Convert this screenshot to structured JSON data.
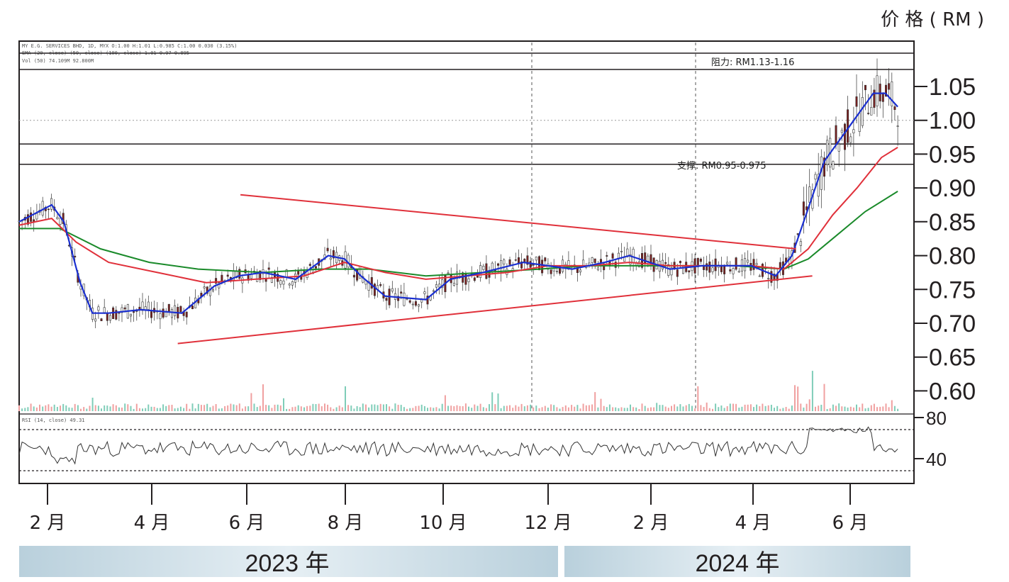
{
  "chart_data": {
    "type": "candlestick",
    "title": "",
    "y_axis_title": "价 格 ( RM )",
    "header_lines": [
      "MY E.G. SERVICES BHD, 1D, MYX  O:1.00  H:1.01  L:0.985  C:1.00  0.030 (3.15%)",
      "EMA (20, close) (50, close) (100, close)  1.01  0.97  0.895",
      "Vol (50)  74.109M  92.800M"
    ],
    "price_ticks": [
      "1.05",
      "1.00",
      "0.95",
      "0.90",
      "0.85",
      "0.80",
      "0.75",
      "0.70",
      "0.65",
      "0.60"
    ],
    "price_range": [
      0.57,
      1.115
    ],
    "rsi_label": "RSI (14, close)  49.31",
    "rsi_ticks": [
      "80",
      "40"
    ],
    "rsi_range": [
      0,
      100
    ],
    "rsi_bands": [
      70,
      30
    ],
    "months": [
      "2 月",
      "4 月",
      "6 月",
      "8 月",
      "10 月",
      "12 月",
      "2 月",
      "4 月",
      "6 月"
    ],
    "years": [
      "2023 年",
      "2024 年"
    ],
    "annotations": {
      "resistance": {
        "text": "阻力: RM1.13-1.16"
      },
      "support": {
        "text": "支撑: RM0.95-0.975",
        "range": [
          0.935,
          0.965
        ]
      }
    },
    "trendlines": {
      "upper": [
        {
          "x": 0.272,
          "y": 0.89
        },
        {
          "x": 0.955,
          "y": 0.81
        }
      ],
      "lower": [
        {
          "x": 0.195,
          "y": 0.67
        },
        {
          "x": 0.975,
          "y": 0.77
        }
      ]
    },
    "ema_points": {
      "ema20": [
        [
          0.0,
          0.85
        ],
        [
          0.04,
          0.875
        ],
        [
          0.055,
          0.85
        ],
        [
          0.075,
          0.76
        ],
        [
          0.09,
          0.715
        ],
        [
          0.11,
          0.715
        ],
        [
          0.15,
          0.72
        ],
        [
          0.2,
          0.715
        ],
        [
          0.24,
          0.755
        ],
        [
          0.27,
          0.77
        ],
        [
          0.3,
          0.775
        ],
        [
          0.34,
          0.765
        ],
        [
          0.38,
          0.8
        ],
        [
          0.4,
          0.795
        ],
        [
          0.42,
          0.77
        ],
        [
          0.45,
          0.74
        ],
        [
          0.5,
          0.735
        ],
        [
          0.53,
          0.765
        ],
        [
          0.57,
          0.775
        ],
        [
          0.62,
          0.79
        ],
        [
          0.68,
          0.78
        ],
        [
          0.72,
          0.79
        ],
        [
          0.75,
          0.8
        ],
        [
          0.8,
          0.78
        ],
        [
          0.84,
          0.785
        ],
        [
          0.87,
          0.785
        ],
        [
          0.9,
          0.785
        ],
        [
          0.93,
          0.77
        ],
        [
          0.95,
          0.8
        ],
        [
          0.97,
          0.87
        ],
        [
          0.99,
          0.94
        ],
        [
          1.02,
          0.99
        ],
        [
          1.05,
          1.04
        ],
        [
          1.065,
          1.04
        ],
        [
          1.08,
          1.02
        ]
      ],
      "ema50": [
        [
          0.0,
          0.845
        ],
        [
          0.04,
          0.855
        ],
        [
          0.07,
          0.82
        ],
        [
          0.11,
          0.79
        ],
        [
          0.17,
          0.775
        ],
        [
          0.23,
          0.76
        ],
        [
          0.29,
          0.765
        ],
        [
          0.35,
          0.77
        ],
        [
          0.4,
          0.79
        ],
        [
          0.45,
          0.775
        ],
        [
          0.5,
          0.765
        ],
        [
          0.55,
          0.77
        ],
        [
          0.6,
          0.775
        ],
        [
          0.65,
          0.785
        ],
        [
          0.7,
          0.785
        ],
        [
          0.75,
          0.79
        ],
        [
          0.8,
          0.785
        ],
        [
          0.85,
          0.785
        ],
        [
          0.9,
          0.785
        ],
        [
          0.94,
          0.78
        ],
        [
          0.97,
          0.81
        ],
        [
          1.0,
          0.86
        ],
        [
          1.03,
          0.9
        ],
        [
          1.06,
          0.945
        ],
        [
          1.08,
          0.96
        ]
      ],
      "ema100": [
        [
          0.0,
          0.84
        ],
        [
          0.05,
          0.84
        ],
        [
          0.1,
          0.81
        ],
        [
          0.16,
          0.79
        ],
        [
          0.22,
          0.78
        ],
        [
          0.3,
          0.775
        ],
        [
          0.37,
          0.78
        ],
        [
          0.43,
          0.78
        ],
        [
          0.5,
          0.77
        ],
        [
          0.57,
          0.775
        ],
        [
          0.64,
          0.78
        ],
        [
          0.7,
          0.785
        ],
        [
          0.76,
          0.785
        ],
        [
          0.82,
          0.785
        ],
        [
          0.88,
          0.785
        ],
        [
          0.94,
          0.78
        ],
        [
          0.97,
          0.795
        ],
        [
          1.0,
          0.825
        ],
        [
          1.04,
          0.865
        ],
        [
          1.08,
          0.895
        ]
      ]
    },
    "grid": false,
    "legend": "none"
  }
}
